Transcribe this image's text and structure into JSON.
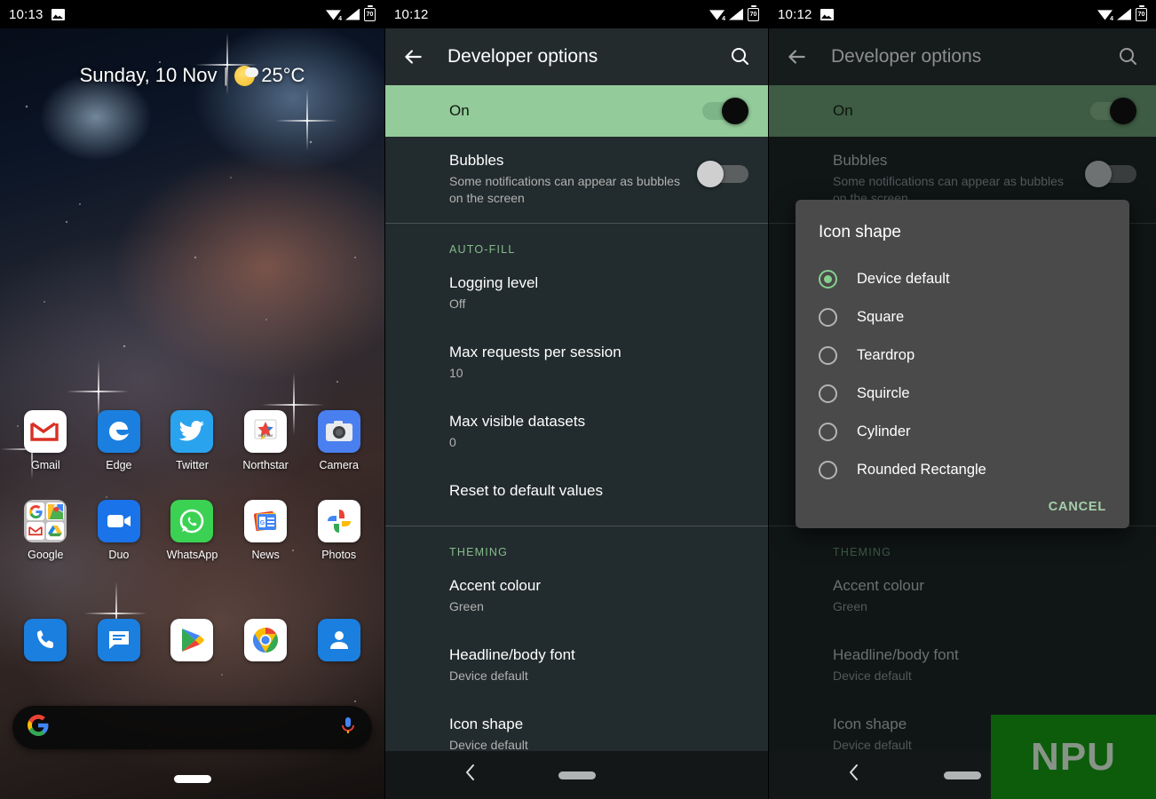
{
  "home": {
    "statusbar": {
      "time": "10:13",
      "screenshot_icon": "image-icon",
      "wifi_icon": "wifi-icon",
      "wifi_badge": "4",
      "signal_icon": "signal-icon",
      "battery_icon": "battery-icon",
      "battery_level": "70"
    },
    "widget": {
      "date": "Sunday, 10 Nov",
      "separator": "|",
      "weather_icon": "partly-sunny-icon",
      "temperature": "25°C"
    },
    "rows": [
      [
        {
          "label": "Gmail",
          "icon": "gmail-icon"
        },
        {
          "label": "Edge",
          "icon": "edge-icon"
        },
        {
          "label": "Twitter",
          "icon": "twitter-icon"
        },
        {
          "label": "Northstar",
          "icon": "northstar-icon"
        },
        {
          "label": "Camera",
          "icon": "camera-icon"
        }
      ],
      [
        {
          "label": "Google",
          "icon": "google-folder-icon"
        },
        {
          "label": "Duo",
          "icon": "duo-icon"
        },
        {
          "label": "WhatsApp",
          "icon": "whatsapp-icon"
        },
        {
          "label": "News",
          "icon": "google-news-icon"
        },
        {
          "label": "Photos",
          "icon": "google-photos-icon"
        }
      ],
      [
        {
          "label": "",
          "icon": "phone-icon"
        },
        {
          "label": "",
          "icon": "messages-icon"
        },
        {
          "label": "",
          "icon": "play-store-icon"
        },
        {
          "label": "",
          "icon": "chrome-icon"
        },
        {
          "label": "",
          "icon": "contacts-icon"
        }
      ]
    ],
    "search": {
      "google_icon": "google-g-icon",
      "mic_icon": "microphone-icon",
      "placeholder": ""
    }
  },
  "settings": {
    "statusbar": {
      "time": "10:12",
      "screenshot_icon": "image-icon",
      "wifi_icon": "wifi-icon",
      "wifi_badge": "4",
      "signal_icon": "signal-icon",
      "battery_icon": "battery-icon",
      "battery_level": "70"
    },
    "appbar": {
      "back_icon": "back-arrow-icon",
      "title": "Developer options",
      "search_icon": "search-icon"
    },
    "master_toggle": {
      "label": "On",
      "state": "on"
    },
    "bubbles": {
      "title": "Bubbles",
      "summary": "Some notifications can appear as bubbles on the screen",
      "state": "off"
    },
    "sections": [
      {
        "header": "AUTO-FILL",
        "items": [
          {
            "title": "Logging level",
            "value": "Off"
          },
          {
            "title": "Max requests per session",
            "value": "10"
          },
          {
            "title": "Max visible datasets",
            "value": "0"
          },
          {
            "title": "Reset to default values",
            "value": ""
          }
        ]
      },
      {
        "header": "THEMING",
        "items": [
          {
            "title": "Accent colour",
            "value": "Green"
          },
          {
            "title": "Headline/body font",
            "value": "Device default"
          },
          {
            "title": "Icon shape",
            "value": "Device default"
          }
        ]
      }
    ],
    "navbar": {
      "back_icon": "nav-back-icon",
      "home_pill": "home-indicator"
    }
  },
  "dialog": {
    "title": "Icon shape",
    "options": [
      {
        "label": "Device default",
        "selected": true
      },
      {
        "label": "Square",
        "selected": false
      },
      {
        "label": "Teardrop",
        "selected": false
      },
      {
        "label": "Squircle",
        "selected": false
      },
      {
        "label": "Cylinder",
        "selected": false
      },
      {
        "label": "Rounded Rectangle",
        "selected": false
      }
    ],
    "cancel_label": "CANCEL"
  },
  "watermark": {
    "text": "NPU"
  },
  "colors": {
    "accent_green": "#86d08e",
    "toggle_on_track": "#7db488",
    "master_row_bg": "#93cb9a",
    "settings_bg": "#222b2d",
    "appbar_bg": "#232b2d",
    "dialog_bg": "#4a4a4a",
    "watermark_bg": "#0c5c0c"
  }
}
